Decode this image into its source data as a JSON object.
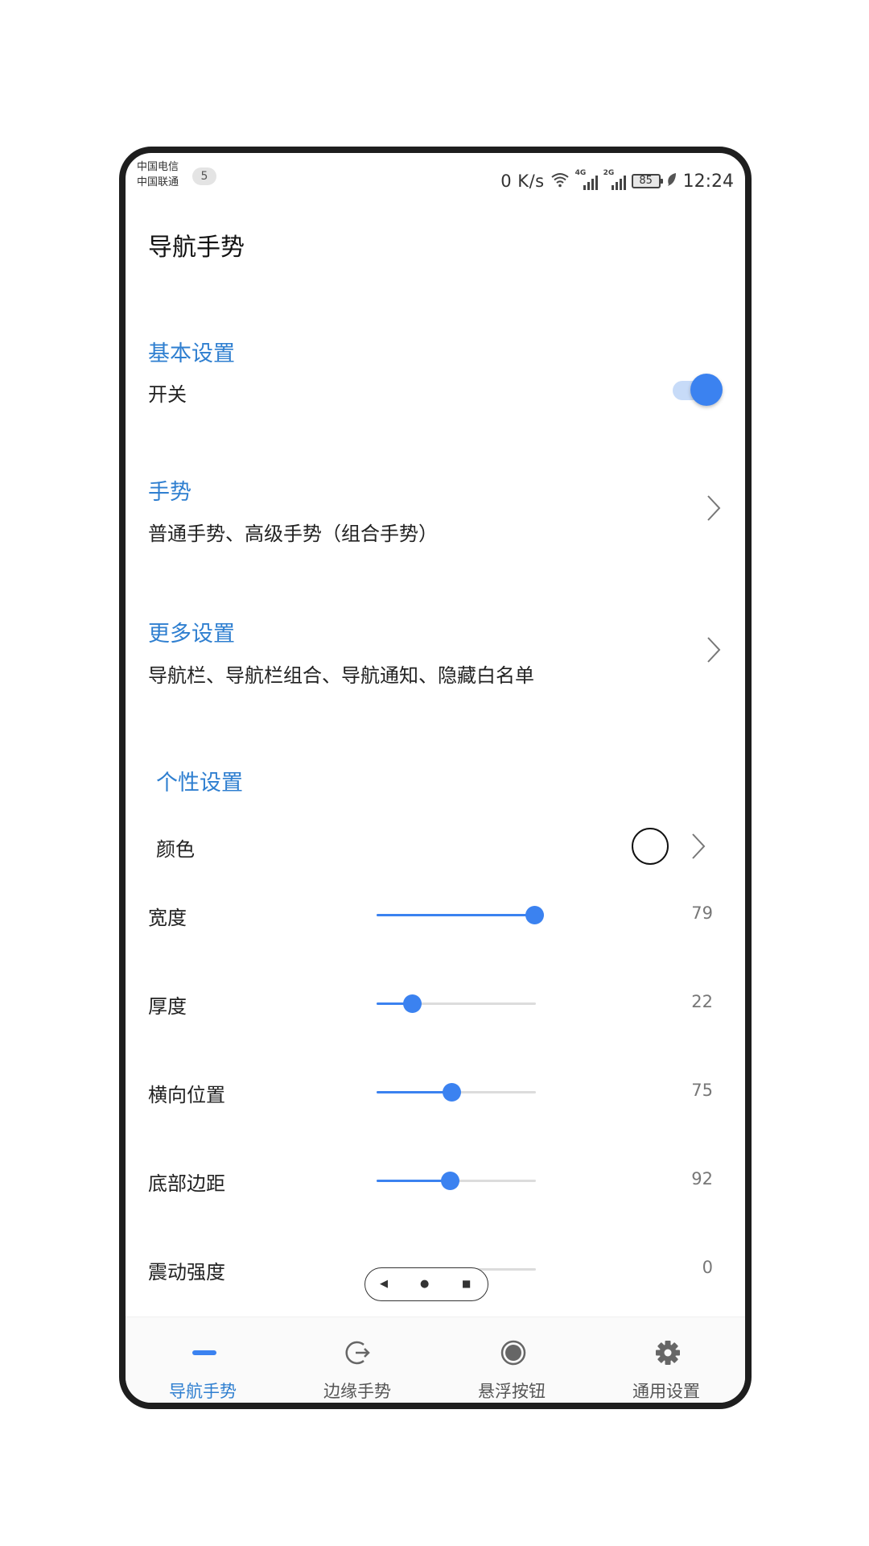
{
  "status_bar": {
    "carrier_1": "中国电信",
    "carrier_2": "中国联通",
    "notification_count": "5",
    "net_speed": "0 K/s",
    "net_type_1": "4G",
    "net_type_2": "2G",
    "battery": "85",
    "time": "12:24"
  },
  "page": {
    "title": "导航手势"
  },
  "sections": {
    "basic": {
      "label": "基本设置",
      "switch_label": "开关",
      "switch_on": true
    },
    "gesture": {
      "label": "手势",
      "summary": "普通手势、高级手势（组合手势）"
    },
    "more": {
      "label": "更多设置",
      "summary": "导航栏、导航栏组合、导航通知、隐藏白名单"
    },
    "personal": {
      "label": "个性设置",
      "color_label": "颜色",
      "color_value": "#ffffff"
    }
  },
  "sliders": [
    {
      "label": "宽度",
      "value": "79",
      "fraction": 0.99
    },
    {
      "label": "厚度",
      "value": "22",
      "fraction": 0.22
    },
    {
      "label": "横向位置",
      "value": "75",
      "fraction": 0.47
    },
    {
      "label": "底部边距",
      "value": "92",
      "fraction": 0.46
    },
    {
      "label": "震动强度",
      "value": "0",
      "fraction": 0.0
    }
  ],
  "nav_pill": {
    "back": "◀",
    "home": "●",
    "recent": "■"
  },
  "bottom_nav": [
    {
      "label": "导航手势",
      "icon": "minus-bar-icon",
      "active": true
    },
    {
      "label": "边缘手势",
      "icon": "edge-arrow-icon",
      "active": false
    },
    {
      "label": "悬浮按钮",
      "icon": "floating-dot-icon",
      "active": false
    },
    {
      "label": "通用设置",
      "icon": "gear-icon",
      "active": false
    }
  ],
  "colors": {
    "accent": "#3b82f0",
    "section_text": "#2f7fd0"
  }
}
